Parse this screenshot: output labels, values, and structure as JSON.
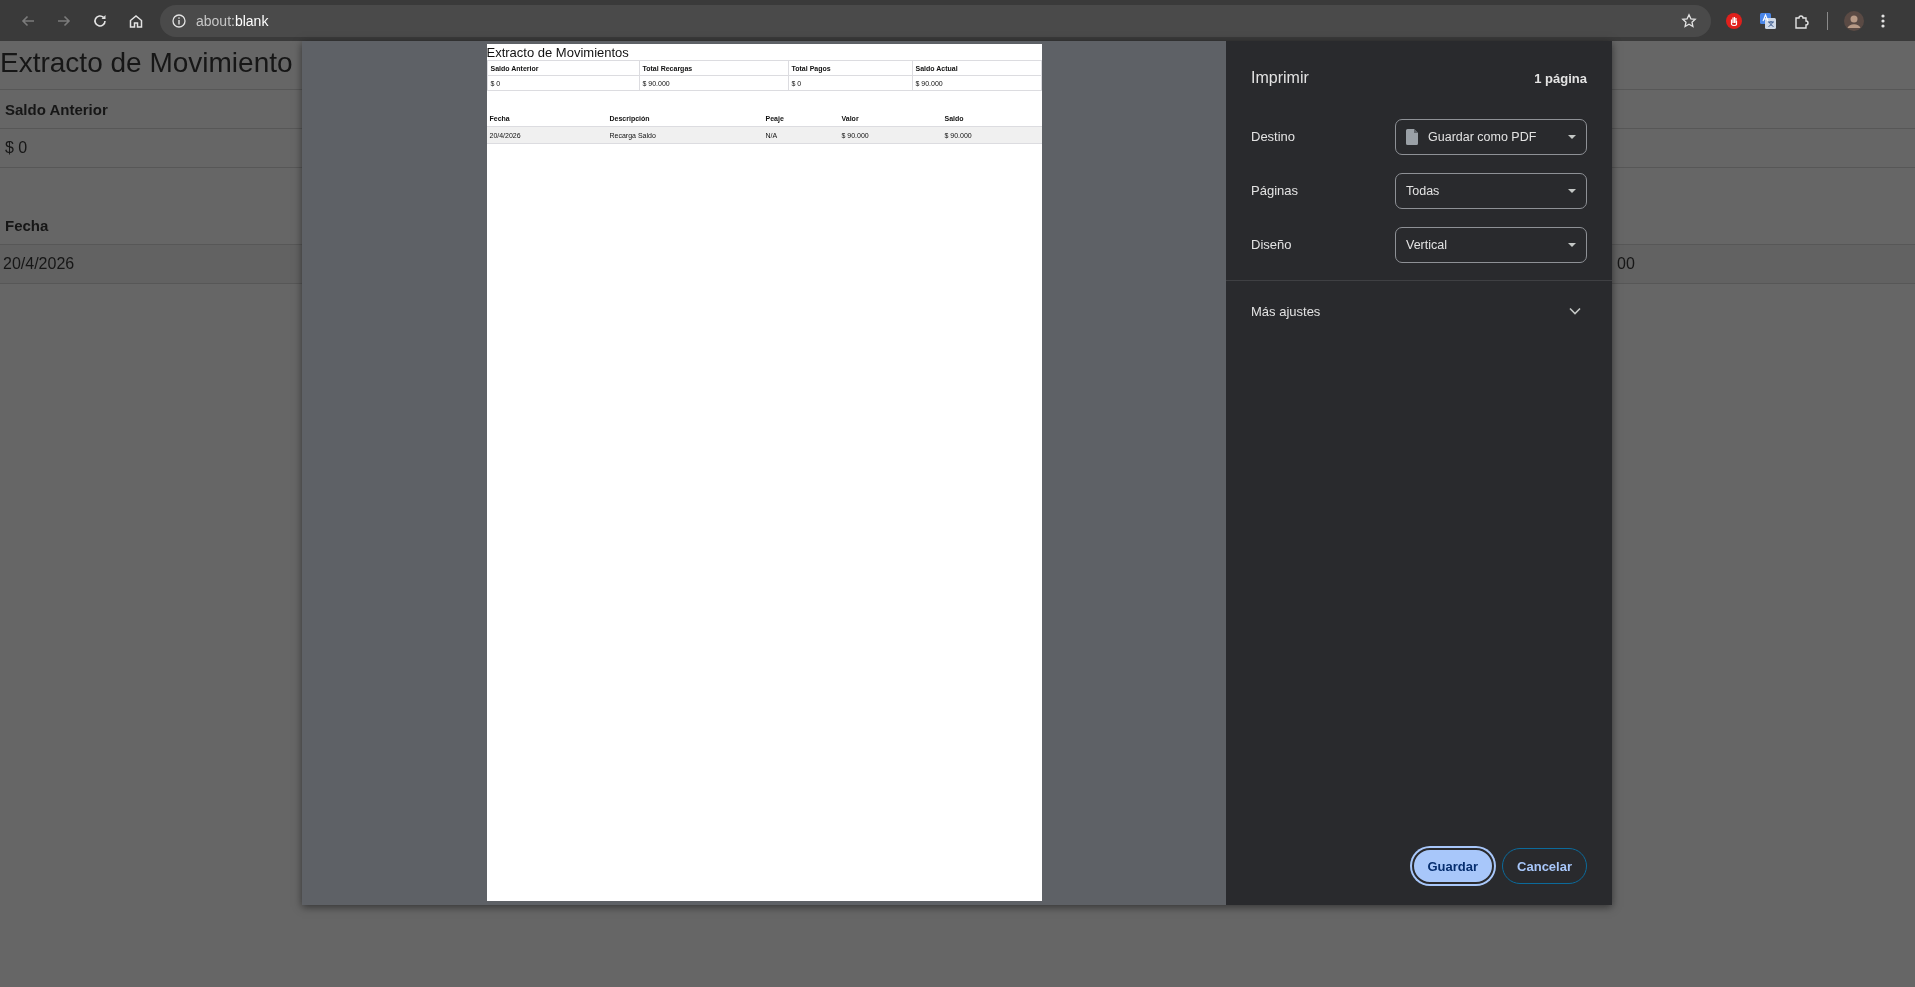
{
  "browser": {
    "navigation": [
      {
        "kind": "back",
        "disabled": true
      },
      {
        "kind": "forward",
        "disabled": true
      },
      {
        "kind": "reload",
        "disabled": false
      },
      {
        "kind": "home",
        "disabled": false
      }
    ],
    "url": "about:**blank**"
  },
  "background_page": {
    "title": "Extracto de Movimiento",
    "summary": {
      "header": "Saldo Anterior",
      "value": "$ 0"
    },
    "movements": {
      "header": "Fecha",
      "row": [
        "20/4/2026",
        "00"
      ]
    }
  },
  "print_dialog": {
    "preview": {
      "title": "Extracto de Movimientos",
      "summary": [
        {
          "label": "Saldo Anterior",
          "value": "$ 0"
        },
        {
          "label": "Total Recargas",
          "value": "$ 90.000"
        },
        {
          "label": "Total Pagos",
          "value": "$ 0"
        },
        {
          "label": "Saldo Actual",
          "value": "$ 90.000"
        }
      ],
      "columns": [
        "Fecha",
        "Descripción",
        "Peaje",
        "Valor",
        "Saldo"
      ],
      "rows": [
        [
          "20/4/2026",
          "Recarga Saldo",
          "N/A",
          "$ 90.000",
          "$ 90.000"
        ]
      ]
    },
    "settings": {
      "title": "Imprimir",
      "page_count": "1 página",
      "fields": [
        {
          "label": "Destino",
          "value": "Guardar como PDF",
          "kind": "destination"
        },
        {
          "label": "Páginas",
          "value": "Todas",
          "kind": "select"
        },
        {
          "label": "Diseño",
          "value": "Vertical",
          "kind": "select"
        }
      ],
      "more_settings": {
        "label": "Más ajustes",
        "expanded": false
      },
      "buttons": [
        {
          "label": "Guardar",
          "kind": "primary"
        },
        {
          "label": "Cancelar",
          "kind": "secondary"
        }
      ]
    }
  }
}
